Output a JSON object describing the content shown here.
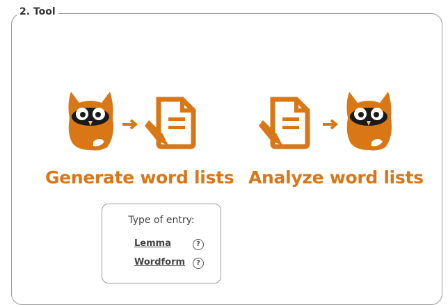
{
  "section": {
    "legend": "2. Tool"
  },
  "tools": {
    "generate": {
      "label": "Generate word lists"
    },
    "analyze": {
      "label": "Analyze word lists"
    }
  },
  "entry_type": {
    "title": "Type of entry:",
    "options": [
      {
        "label": "Lemma",
        "help": "?"
      },
      {
        "label": "Wordform",
        "help": "?"
      }
    ]
  },
  "colors": {
    "accent": "#d97716",
    "owl_face": "#ffffff",
    "border": "#9a9a9a"
  },
  "icons": [
    "owl-icon",
    "arrow-right-icon",
    "document-pen-icon"
  ]
}
